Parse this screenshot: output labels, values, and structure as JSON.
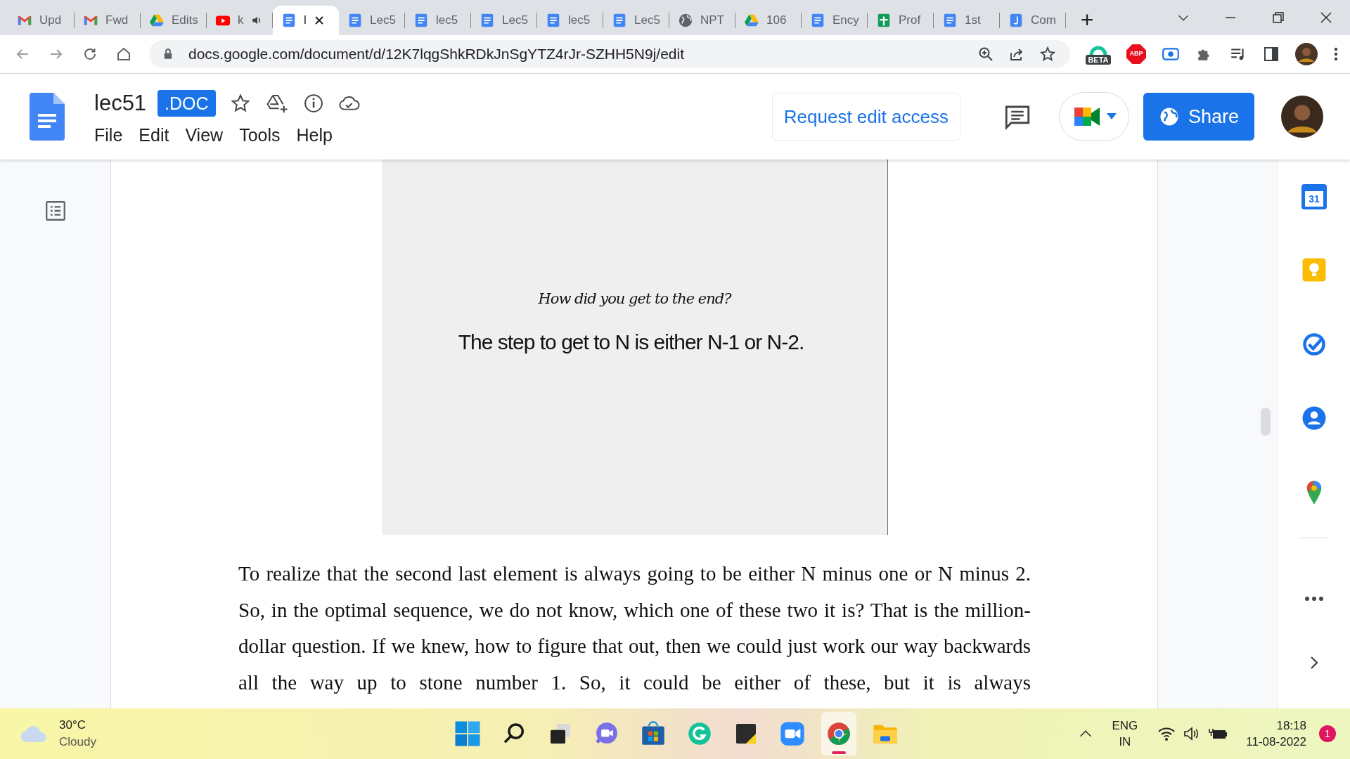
{
  "browser": {
    "tabs": [
      {
        "label": "Upd",
        "kind": "gmail",
        "audio": false,
        "selected": false
      },
      {
        "label": "Fwd",
        "kind": "gmail",
        "audio": false,
        "selected": false
      },
      {
        "label": "Edits",
        "kind": "drive",
        "audio": false,
        "selected": false
      },
      {
        "label": "k",
        "kind": "youtube",
        "audio": true,
        "selected": false
      },
      {
        "label": "l",
        "kind": "docs",
        "audio": false,
        "selected": true
      },
      {
        "label": "Lec5",
        "kind": "docs",
        "audio": false,
        "selected": false
      },
      {
        "label": "lec5",
        "kind": "docs",
        "audio": false,
        "selected": false
      },
      {
        "label": "Lec5",
        "kind": "docs",
        "audio": false,
        "selected": false
      },
      {
        "label": "lec5",
        "kind": "docs",
        "audio": false,
        "selected": false
      },
      {
        "label": "Lec5",
        "kind": "docs",
        "audio": false,
        "selected": false
      },
      {
        "label": "NPT",
        "kind": "globe",
        "audio": false,
        "selected": false
      },
      {
        "label": "106",
        "kind": "drive",
        "audio": false,
        "selected": false
      },
      {
        "label": "Ency",
        "kind": "docs",
        "audio": false,
        "selected": false
      },
      {
        "label": "Prof",
        "kind": "sheets",
        "audio": false,
        "selected": false
      },
      {
        "label": "1st",
        "kind": "docs",
        "audio": false,
        "selected": false
      },
      {
        "label": "Com",
        "kind": "jamboard",
        "audio": false,
        "selected": false
      }
    ],
    "new_tab": "+",
    "url": "docs.google.com/document/d/12K7lqgShkRDkJnSgYTZ4rJr-SZHH5N9j/edit",
    "extension_badge": "BETA",
    "adblock_label": "ABP"
  },
  "docs": {
    "title": "lec51",
    "format_badge": ".DOC",
    "menu": [
      "File",
      "Edit",
      "View",
      "Tools",
      "Help"
    ],
    "request_button": "Request edit access",
    "share_button": "Share"
  },
  "document": {
    "slide": {
      "handwritten": "How did you get to the end?",
      "caption": "The step to get to N is either N-1 or N-2."
    },
    "paragraph": "To realize that the second last element is always going to be either N minus one or N minus 2. So, in the optimal sequence, we do not know, which one of these two it is? That is the million-dollar question. If we knew, how to figure that out, then we could just work our way backwards all the way up to stone number 1. So, it could be either of these, but it is always"
  },
  "side_panel": {
    "calendar_day": "31"
  },
  "taskbar": {
    "temperature": "30°C",
    "weather": "Cloudy",
    "apps": [
      {
        "kind": "start",
        "selected": false
      },
      {
        "kind": "search",
        "selected": false
      },
      {
        "kind": "taskview",
        "selected": false
      },
      {
        "kind": "chat",
        "selected": false
      },
      {
        "kind": "store",
        "selected": false
      },
      {
        "kind": "grammarly",
        "selected": false
      },
      {
        "kind": "sticky",
        "selected": false
      },
      {
        "kind": "zoom",
        "selected": false
      },
      {
        "kind": "chrome",
        "selected": true
      },
      {
        "kind": "folder",
        "selected": false
      }
    ],
    "language": "ENG",
    "region": "IN",
    "time": "18:18",
    "date": "11-08-2022",
    "notifications": "1"
  }
}
